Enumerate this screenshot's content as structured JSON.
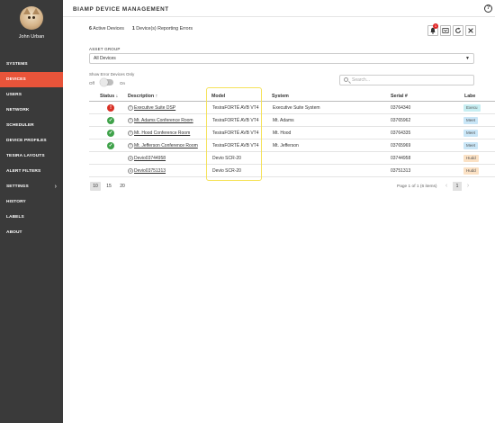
{
  "user": {
    "name": "John Urban"
  },
  "sidebar": {
    "items": [
      {
        "label": "SYSTEMS",
        "active": false
      },
      {
        "label": "DEVICES",
        "active": true
      },
      {
        "label": "USERS",
        "active": false
      },
      {
        "label": "NETWORK",
        "active": false
      },
      {
        "label": "SCHEDULER",
        "active": false
      },
      {
        "label": "DEVICE PROFILES",
        "active": false
      },
      {
        "label": "TESIRA LAYOUTS",
        "active": false
      },
      {
        "label": "ALERT FILTERS",
        "active": false
      },
      {
        "label": "SETTINGS",
        "active": false,
        "has_submenu": true
      },
      {
        "label": "HISTORY",
        "active": false
      },
      {
        "label": "LABELS",
        "active": false
      },
      {
        "label": "ABOUT",
        "active": false
      }
    ]
  },
  "header": {
    "title": "BIAMP DEVICE MANAGEMENT",
    "help_icon": "?"
  },
  "stats": {
    "active_count": "6",
    "active_label": "Active Devices",
    "error_count": "1",
    "error_label": "Device(s) Reporting Errors"
  },
  "toolbar": {
    "notification_count": "1",
    "icons": [
      "bell-icon",
      "export-icon",
      "refresh-icon",
      "close-icon"
    ]
  },
  "asset_group": {
    "label": "ASSET GROUP",
    "value": "All Devices"
  },
  "error_filter": {
    "label": "Show Error Devices Only",
    "off": "Off",
    "on": "On",
    "enabled": false
  },
  "search": {
    "placeholder": "Search..."
  },
  "table": {
    "headers": {
      "status": "Status ↓",
      "description": "Description ↑",
      "model": "Model",
      "system": "System",
      "serial": "Serial #",
      "labels": "Labe"
    },
    "rows": [
      {
        "status": "error",
        "status_glyph": "!",
        "device_glyph": "T",
        "description": "Executive Suite DSP",
        "model": "TesiraFORTÉ AVB VT4",
        "system": "Executive Suite System",
        "serial": "03764340",
        "label": "Execu",
        "label_color": "#c7eef2"
      },
      {
        "status": "ok",
        "status_glyph": "✓",
        "device_glyph": "T",
        "description": "Mt. Adams Conference Room",
        "model": "TesiraFORTÉ AVB VT4",
        "system": "Mt. Adams",
        "serial": "03765962",
        "label": "Meet",
        "label_color": "#c9e6f7"
      },
      {
        "status": "ok",
        "status_glyph": "✓",
        "device_glyph": "T",
        "description": "Mt. Hood Conference Room",
        "model": "TesiraFORTÉ AVB VT4",
        "system": "Mt. Hood",
        "serial": "03764335",
        "label": "Meet",
        "label_color": "#c9e6f7"
      },
      {
        "status": "ok",
        "status_glyph": "✓",
        "device_glyph": "T",
        "description": "Mt. Jefferson Conference Room",
        "model": "TesiraFORTÉ AVB VT4",
        "system": "Mt. Jefferson",
        "serial": "03765969",
        "label": "Meet",
        "label_color": "#c9e6f7"
      },
      {
        "status": "none",
        "status_glyph": "",
        "device_glyph": "d",
        "description": "Devio03744958",
        "model": "Devio SCR-20",
        "system": "",
        "serial": "03744958",
        "label": "Hudd",
        "label_color": "#fbe1c4"
      },
      {
        "status": "none",
        "status_glyph": "",
        "device_glyph": "d",
        "description": "Devio03751313",
        "model": "Devio SCR-20",
        "system": "",
        "serial": "03751313",
        "label": "Hudd",
        "label_color": "#fbe1c4"
      }
    ]
  },
  "pagination": {
    "page_sizes": [
      "10",
      "15",
      "20"
    ],
    "active_size": "10",
    "info": "Page 1 of 1 (6 items)",
    "prev": "‹",
    "current": "1",
    "next": "›"
  }
}
